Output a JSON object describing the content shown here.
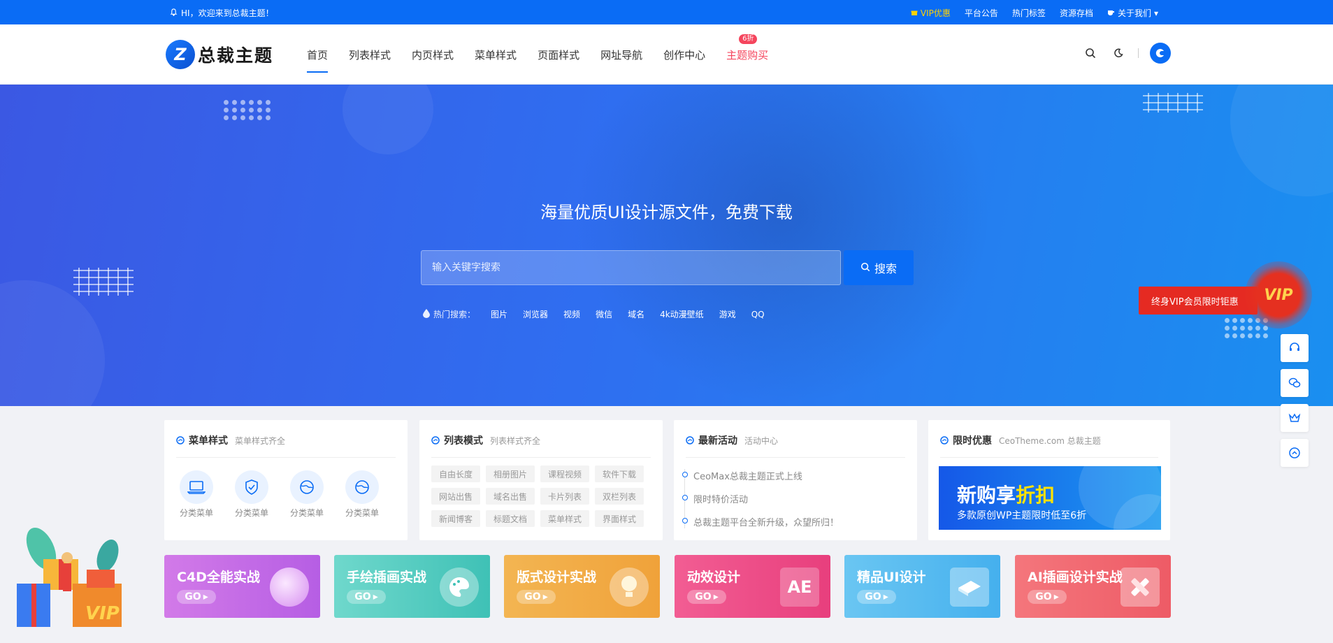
{
  "topbar": {
    "welcome": "HI，欢迎来到总裁主题！",
    "links": [
      {
        "label": "VIP优惠"
      },
      {
        "label": "平台公告"
      },
      {
        "label": "热门标签"
      },
      {
        "label": "资源存档"
      },
      {
        "label": "关于我们"
      }
    ]
  },
  "header": {
    "logo_text": "总裁主题",
    "nav": [
      {
        "label": "首页"
      },
      {
        "label": "列表样式"
      },
      {
        "label": "内页样式"
      },
      {
        "label": "菜单样式"
      },
      {
        "label": "页面样式"
      },
      {
        "label": "网址导航"
      },
      {
        "label": "创作中心"
      },
      {
        "label": "主题购买",
        "badge": "6折"
      }
    ]
  },
  "hero": {
    "title": "海量优质UI设计源文件，免费下载",
    "search_placeholder": "输入关键字搜索",
    "search_button": "搜索",
    "hot_label": "热门搜索：",
    "hot_terms": [
      "图片",
      "浏览器",
      "视频",
      "微信",
      "域名",
      "4k动漫壁纸",
      "游戏",
      "QQ"
    ]
  },
  "floating": {
    "vip_tag": "终身VIP会员限时钜惠",
    "vip_badge": "VIP"
  },
  "cards": [
    {
      "title": "菜单样式",
      "subtitle": "菜单样式齐全",
      "categories": [
        "分类菜单",
        "分类菜单",
        "分类菜单",
        "分类菜单"
      ]
    },
    {
      "title": "列表模式",
      "subtitle": "列表样式齐全",
      "tags": [
        "自由长度",
        "相册图片",
        "课程视频",
        "软件下载",
        "网站出售",
        "域名出售",
        "卡片列表",
        "双栏列表",
        "新闻博客",
        "标题文档",
        "菜单样式",
        "界面样式"
      ]
    },
    {
      "title": "最新活动",
      "subtitle": "活动中心",
      "news": [
        "CeoMax总裁主题正式上线",
        "限时特价活动",
        "总裁主题平台全新升级，众望所归！"
      ]
    },
    {
      "title": "限时优惠",
      "subtitle": "CeoTheme.com 总裁主题",
      "promo_prefix": "新购享",
      "promo_highlight": "折扣",
      "promo_sub": "多款原创WP主题限时低至6折"
    }
  ],
  "courses": [
    {
      "title": "C4D全能实战",
      "go": "GO",
      "art": "",
      "color": "#c76be6"
    },
    {
      "title": "手绘插画实战",
      "go": "GO",
      "art": "",
      "color": "#4cc9c0"
    },
    {
      "title": "版式设计实战",
      "go": "GO",
      "art": "",
      "color": "#f0a640"
    },
    {
      "title": "动效设计",
      "go": "GO",
      "art": "AE",
      "color": "#ee4f8e"
    },
    {
      "title": "精品UI设计",
      "go": "GO",
      "art": "",
      "color": "#5bbcf0"
    },
    {
      "title": "AI插画设计实战",
      "go": "GO",
      "art": "",
      "color": "#f06a74"
    }
  ],
  "gift": {
    "label": "VIP"
  }
}
